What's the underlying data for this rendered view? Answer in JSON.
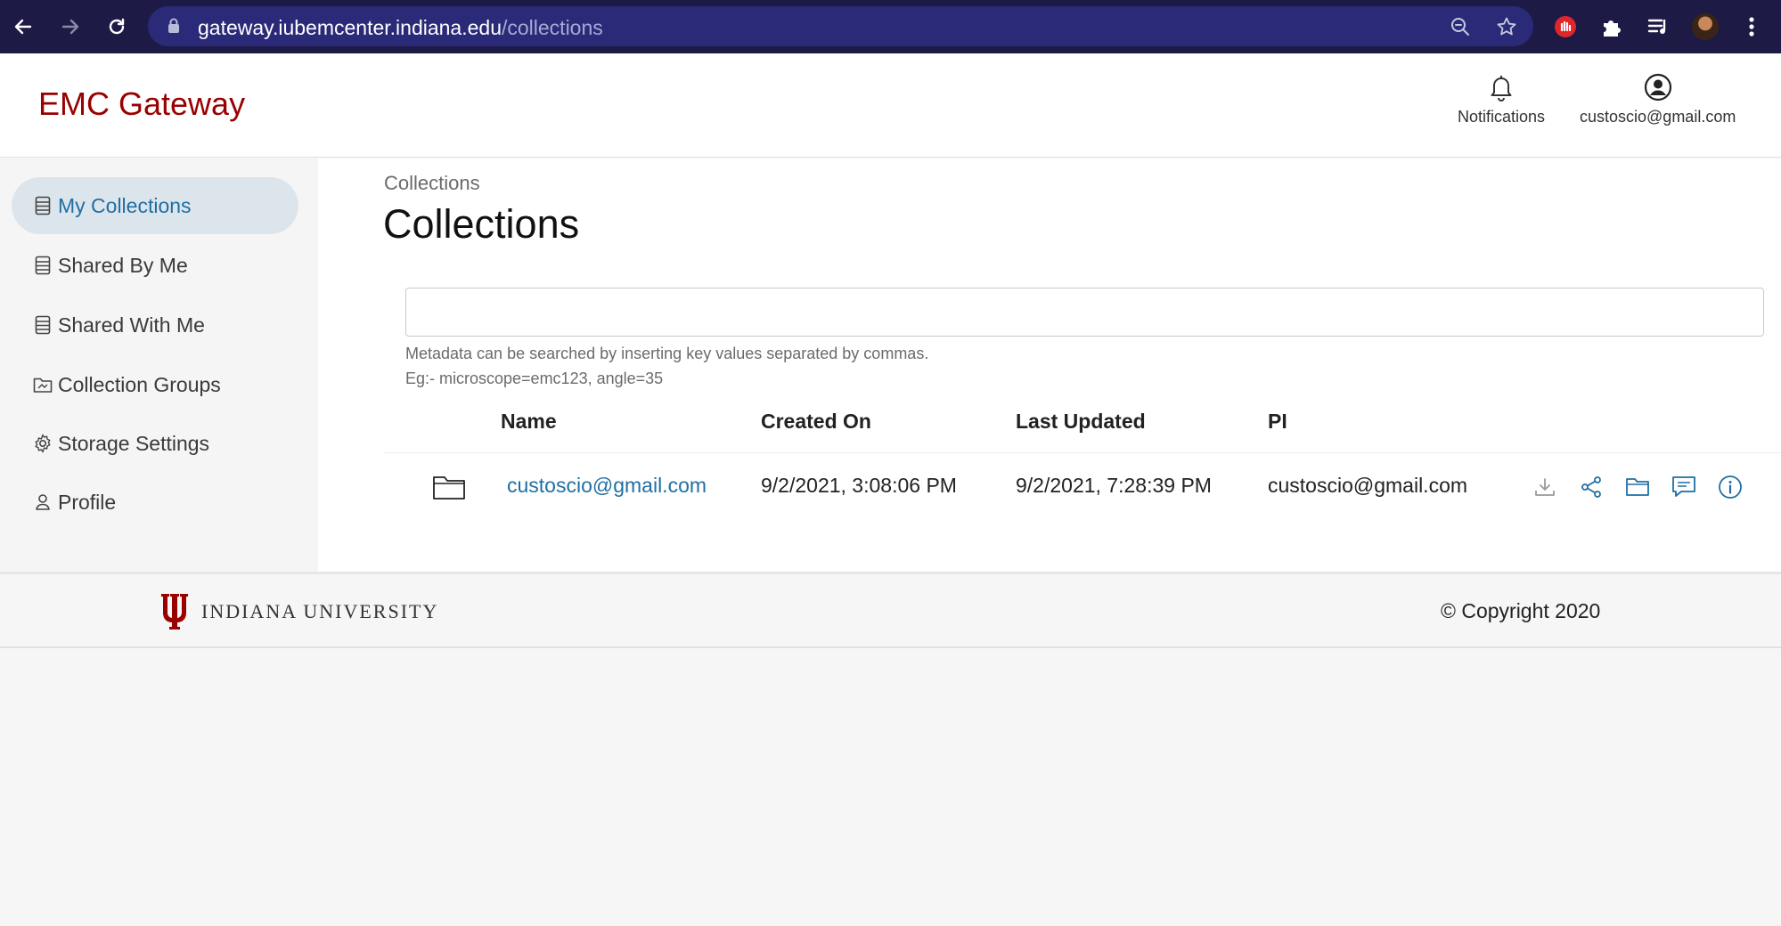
{
  "browser": {
    "url_host": "gateway.iubemcenter.indiana.edu",
    "url_path": "/collections"
  },
  "header": {
    "brand": "EMC Gateway",
    "notifications_label": "Notifications",
    "user_email": "custoscio@gmail.com"
  },
  "sidebar": {
    "items": [
      {
        "label": "My Collections",
        "icon": "collection-icon",
        "active": true
      },
      {
        "label": "Shared By Me",
        "icon": "collection-icon"
      },
      {
        "label": "Shared With Me",
        "icon": "collection-icon"
      },
      {
        "label": "Collection Groups",
        "icon": "folder-group-icon"
      },
      {
        "label": "Storage Settings",
        "icon": "gear-icon"
      },
      {
        "label": "Profile",
        "icon": "user-icon"
      }
    ]
  },
  "main": {
    "breadcrumb": "Collections",
    "title": "Collections",
    "search": {
      "value": "",
      "hint_line1": "Metadata can be searched by inserting key values separated by commas.",
      "hint_line2": "Eg:- microscope=emc123, angle=35"
    },
    "table": {
      "headers": [
        "Name",
        "Created On",
        "Last Updated",
        "PI"
      ],
      "rows": [
        {
          "name": "custoscio@gmail.com",
          "created_on": "9/2/2021, 3:08:06 PM",
          "last_updated": "9/2/2021, 7:28:39 PM",
          "pi": "custoscio@gmail.com"
        }
      ],
      "row_action_icons": [
        "download-icon",
        "share-icon",
        "folder-icon",
        "comment-icon",
        "info-icon"
      ]
    }
  },
  "footer": {
    "university": "INDIANA UNIVERSITY",
    "copyright": "© Copyright 2020"
  },
  "colors": {
    "brand": "#990000",
    "link": "#1f6fa3",
    "active_bg": "#dde5ec",
    "chrome_bg": "#1d1a46",
    "omnibox_bg": "#2a2a78"
  }
}
